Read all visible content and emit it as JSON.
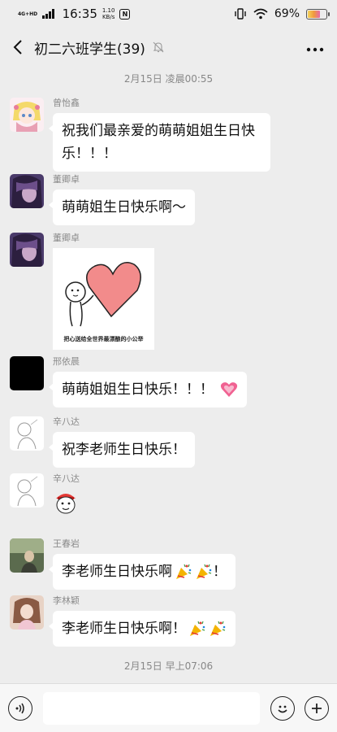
{
  "status": {
    "network": "4G+HD",
    "time": "16:35",
    "speed_value": "1.10",
    "speed_unit": "KB/s",
    "nfc_label": "N",
    "battery": "69%"
  },
  "header": {
    "title": "初二六班学生(39)"
  },
  "timestamps": [
    "2月15日 凌晨00:55",
    "2月15日 早上07:06"
  ],
  "messages": [
    {
      "sender": "曾怡鑫",
      "text": "祝我们最亲爱的萌萌姐姐生日快乐！！！"
    },
    {
      "sender": "董卿卓",
      "text": "萌萌姐生日快乐啊～"
    },
    {
      "sender": "董卿卓",
      "sticker_caption": "把心送给全世界最漂酿的小公举"
    },
    {
      "sender": "邢依晨",
      "text": "萌萌姐姐生日快乐！！！"
    },
    {
      "sender": "辛八达",
      "text": "祝李老师生日快乐！"
    },
    {
      "sender": "辛八达"
    },
    {
      "sender": "王春岩",
      "text": "李老师生日快乐啊",
      "text_after": "！"
    },
    {
      "sender": "李林颖",
      "text": "李老师生日快乐啊！"
    }
  ],
  "icons": {
    "back": "chevron-left-icon",
    "mute": "bell-off-icon",
    "more": "more-dots-icon",
    "voice": "voice-icon",
    "emoji": "smiley-icon",
    "plus": "plus-icon",
    "heart_emoji": "pink-heart-icon",
    "party": "party-popper-icon"
  },
  "colors": {
    "background": "#ededed",
    "bubble": "#ffffff",
    "heart": "#f06292"
  }
}
